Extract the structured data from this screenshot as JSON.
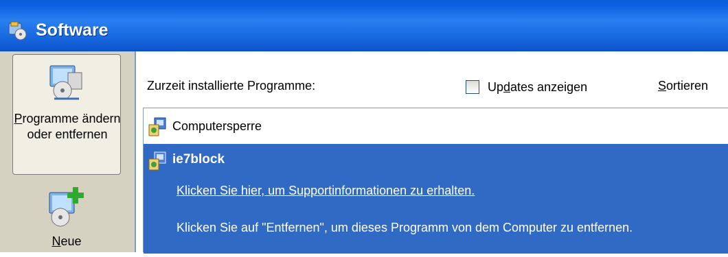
{
  "window": {
    "title": "Software",
    "icon": "software-control-panel-icon"
  },
  "sidebar": {
    "items": [
      {
        "label_underlined": "P",
        "label_rest": "rogramme ändern oder entfernen",
        "icon": "change-remove-programs-icon",
        "active": true
      },
      {
        "label_underlined": "N",
        "label_rest": "eue",
        "icon": "add-new-programs-icon",
        "active": false
      }
    ]
  },
  "main": {
    "installed_label": "Zurzeit installierte Programme:",
    "show_updates": {
      "pre": "Up",
      "underlined": "d",
      "post": "ates anzeigen",
      "checked": false
    },
    "sort": {
      "underlined": "S",
      "rest": "ortieren"
    }
  },
  "programs": [
    {
      "name": "Computersperre",
      "selected": false,
      "icon": "installer-package-icon"
    },
    {
      "name": "ie7block",
      "selected": true,
      "icon": "installer-package-icon",
      "support_link": "Klicken Sie hier, um Supportinformationen zu erhalten.",
      "remove_info": "Klicken Sie auf \"Entfernen\", um dieses Programm von dem Computer zu entfernen."
    }
  ],
  "colors": {
    "titlebar": "#2a7ff0",
    "selection": "#316ac5",
    "sidebar": "#d6d2c2"
  }
}
